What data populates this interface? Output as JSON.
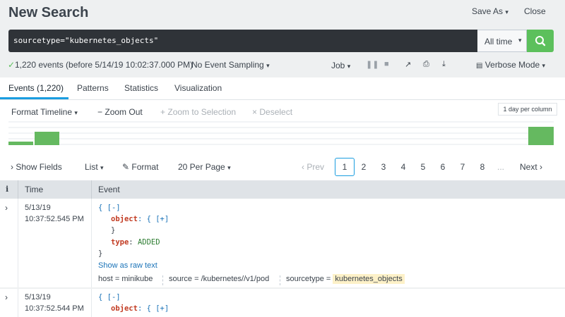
{
  "header": {
    "title": "New Search",
    "save_as_label": "Save As",
    "close_label": "Close"
  },
  "search": {
    "query": "sourcetype=\"kubernetes_objects\"",
    "time_range": "All time"
  },
  "status": {
    "summary": "1,220 events (before 5/14/19 10:02:37.000 PM)",
    "sampling": "No Event Sampling",
    "job": "Job",
    "mode": "Verbose Mode"
  },
  "tabs": [
    {
      "label": "Events (1,220)",
      "active": true
    },
    {
      "label": "Patterns"
    },
    {
      "label": "Statistics"
    },
    {
      "label": "Visualization"
    }
  ],
  "timeline": {
    "format_label": "Format Timeline",
    "zoom_out": "Zoom Out",
    "zoom_selection": "Zoom to Selection",
    "deselect": "Deselect",
    "scale": "1 day per column",
    "bars": [
      {
        "position": "start",
        "level": 0.15
      },
      {
        "position": "second",
        "level": 0.55
      },
      {
        "position": "end",
        "level": 0.75
      }
    ],
    "bar_color": "#65b960"
  },
  "controls": {
    "show_fields": "Show Fields",
    "list": "List",
    "format": "Format",
    "per_page": "20 Per Page"
  },
  "pager": {
    "prev": "Prev",
    "pages": [
      "1",
      "2",
      "3",
      "4",
      "5",
      "6",
      "7",
      "8"
    ],
    "current": "1",
    "ellipsis": "...",
    "next": "Next"
  },
  "table": {
    "info_header": "i",
    "time_header": "Time",
    "event_header": "Event",
    "rows": [
      {
        "date": "5/13/19",
        "time": "10:37:52.545 PM",
        "open": "{ [-]",
        "object_key": "object",
        "object_val": ": { [+]",
        "close_inner": "}",
        "type_key": "type",
        "type_sep": ":",
        "type_val": "ADDED",
        "close": "}",
        "raw_link": "Show as raw text",
        "host_label": "host =",
        "host_val": "minikube",
        "source_label": "source =",
        "source_val": "/kubernetes//v1/pod",
        "sourcetype_label": "sourcetype =",
        "sourcetype_val": "kubernetes_objects"
      },
      {
        "date": "5/13/19",
        "time": "10:37:52.544 PM",
        "open": "{ [-]",
        "object_key": "object",
        "object_val": ": { [+]"
      }
    ]
  },
  "colors": {
    "accent": "#1a9de0",
    "search_button": "#5cc05c",
    "search_bg": "#2f3338"
  }
}
